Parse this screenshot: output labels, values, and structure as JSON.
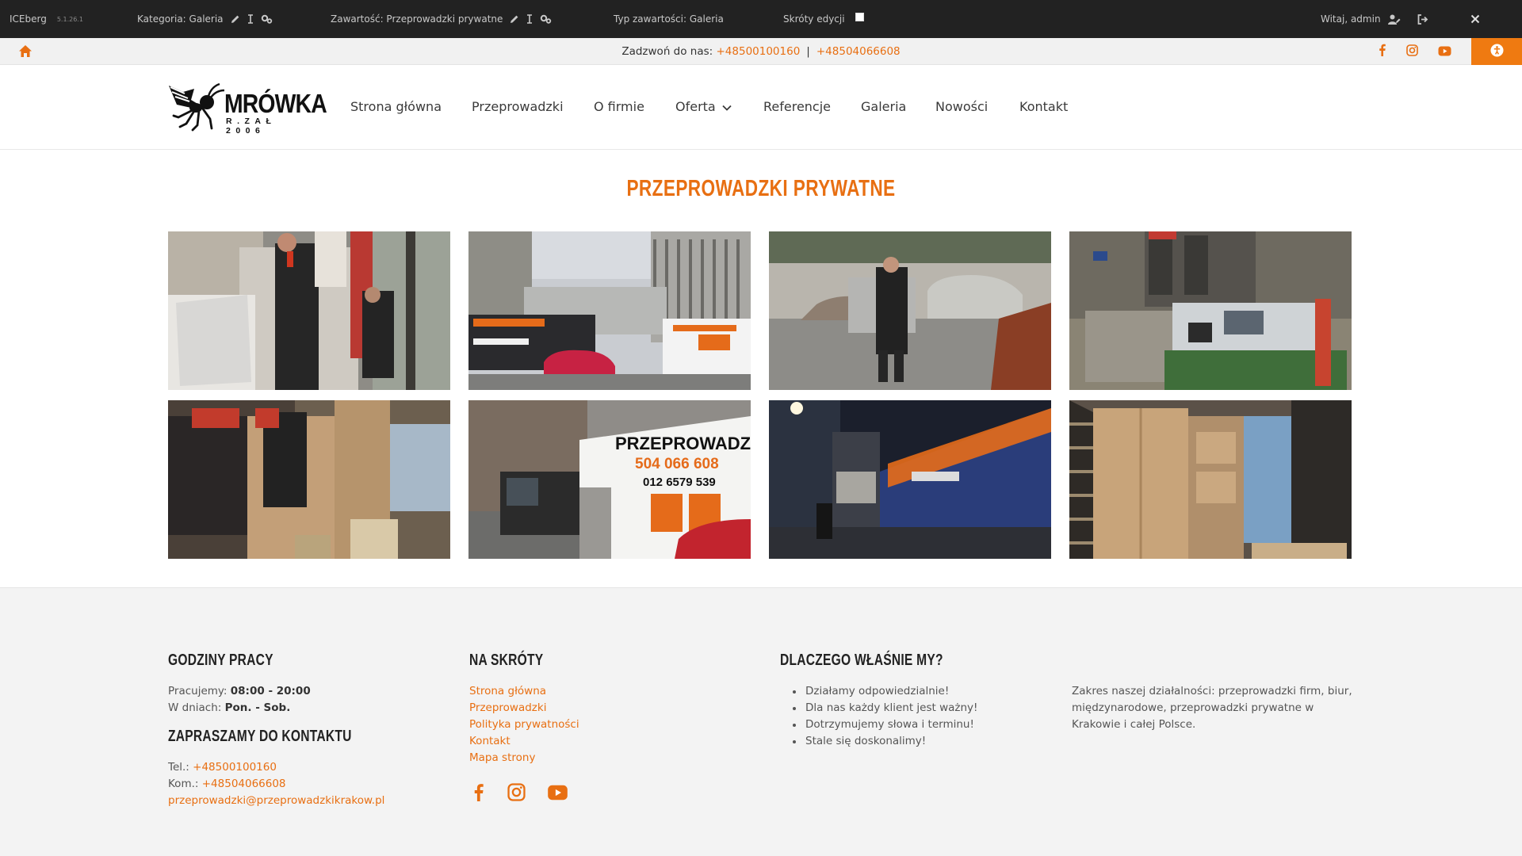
{
  "colors": {
    "accent": "#e86f12",
    "admin_bar": "#222222",
    "topbar": "#f1f1f1",
    "footer": "#f3f3f3"
  },
  "adminbar": {
    "app_name": "ICEberg",
    "version": "5.1.26.1",
    "category": "Kategoria: Galeria",
    "content": "Zawartość: Przeprowadzki prywatne",
    "content_type": "Typ zawartości: Galeria",
    "shortcuts": "Skróty edycji",
    "welcome": "Witaj, admin",
    "icons": [
      "pencil-icon",
      "text-cursor-icon",
      "gears-icon",
      "user-edit-icon",
      "logout-icon",
      "close-icon"
    ]
  },
  "topbar": {
    "call_label": "Zadzwoń do nas:",
    "phone1": "+48500100160",
    "separator": "|",
    "phone2": "+48504066608",
    "icons": [
      "home-icon",
      "facebook-icon",
      "instagram-icon",
      "youtube-icon",
      "accessibility-icon"
    ]
  },
  "logo": {
    "title": "MRÓWKA",
    "subtitle": "R.ZAŁ 2006"
  },
  "nav": {
    "items": [
      {
        "label": "Strona główna"
      },
      {
        "label": "Przeprowadzki"
      },
      {
        "label": "O firmie"
      },
      {
        "label": "Oferta",
        "icon": "chevron-down-icon"
      },
      {
        "label": "Referencje"
      },
      {
        "label": "Galeria"
      },
      {
        "label": "Nowości"
      },
      {
        "label": "Kontakt"
      }
    ]
  },
  "page": {
    "title": "PRZEPROWADZKI PRYWATNE",
    "gallery": [
      {
        "photo": "movers-loading-wrapped-furniture-truck"
      },
      {
        "photo": "moving-trucks-in-front-of-building"
      },
      {
        "photo": "mover-carrying-wrapped-item-street"
      },
      {
        "photo": "office-equipment-on-pallet-outside"
      },
      {
        "photo": "movers-lifting-cabinet-in-truck"
      },
      {
        "photo": "moving-truck-parked-on-street"
      },
      {
        "photo": "moving-truck-at-night"
      },
      {
        "photo": "wardrobe-and-boxes-in-truck"
      }
    ],
    "truck_text": {
      "brand": "PRZEPROWADZKI",
      "phone_a": "504 066 608",
      "phone_b": "012 6579 539"
    }
  },
  "footer": {
    "hours": {
      "heading": "GODZINY PRACY",
      "work_label": "Pracujemy:",
      "work_value": "08:00 - 20:00",
      "days_label": "W dniach:",
      "days_value": "Pon. - Sob."
    },
    "contact": {
      "heading": "ZAPRASZAMY DO KONTAKTU",
      "tel_label": "Tel.:",
      "tel": "+48500100160",
      "kom_label": "Kom.:",
      "kom": "+48504066608",
      "email": "przeprowadzki@przeprowadzkikrakow.pl"
    },
    "shortcuts": {
      "heading": "NA SKRÓTY",
      "links": [
        "Strona główna",
        "Przeprowadzki",
        "Polityka prywatności",
        "Kontakt",
        "Mapa strony"
      ],
      "social_icons": [
        "facebook-icon",
        "instagram-icon",
        "youtube-icon"
      ]
    },
    "why": {
      "heading": "DLACZEGO WŁAŚNIE MY?",
      "items": [
        "Działamy odpowiedzialnie!",
        "Dla nas każdy klient jest ważny!",
        "Dotrzymujemy słowa i terminu!",
        "Stale się doskonalimy!"
      ]
    },
    "about": "Zakres naszej działalności: przeprowadzki firm, biur, międzynarodowe, przeprowadzki prywatne w Krakowie i całej Polsce."
  }
}
